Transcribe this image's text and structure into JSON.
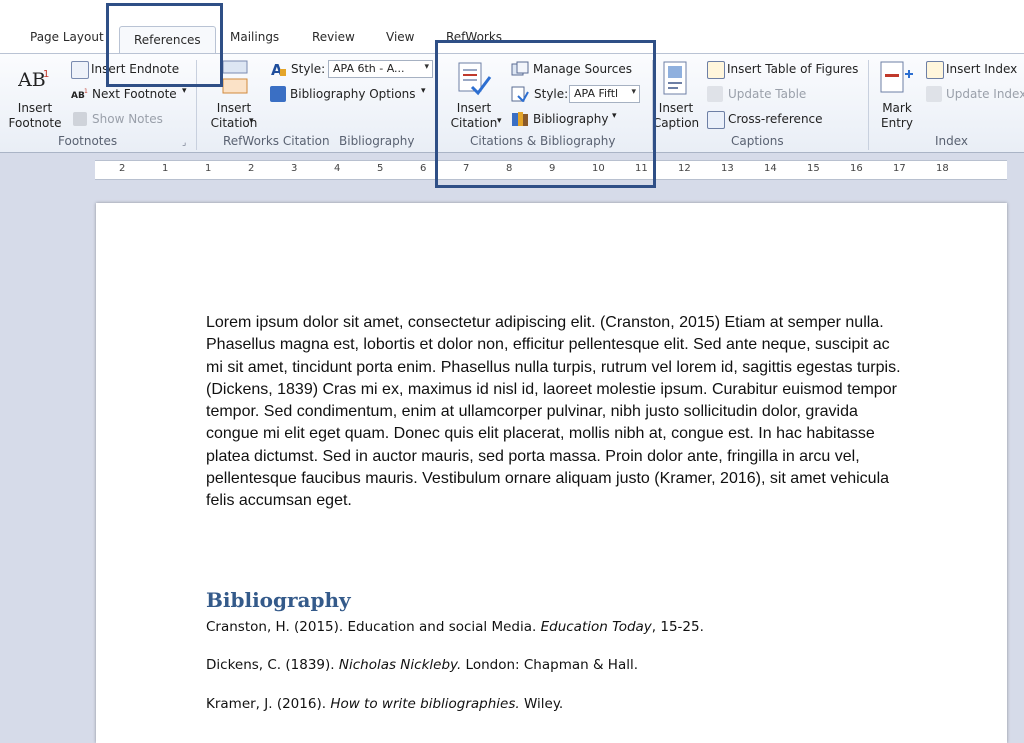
{
  "tabs": {
    "page_layout": "Page Layout",
    "references": "References",
    "mailings": "Mailings",
    "review": "Review",
    "view": "View",
    "refworks": "RefWorks"
  },
  "ribbon": {
    "footnotes": {
      "insert_footnote": "Insert Footnote",
      "insert_footnote_l1": "Insert",
      "insert_footnote_l2": "Footnote",
      "insert_endnote": "Insert Endnote",
      "next_footnote": "Next Footnote",
      "show_notes": "Show Notes",
      "group_label": "Footnotes"
    },
    "refworks": {
      "insert_citation_l1": "Insert",
      "insert_citation_l2": "Citation",
      "style_label": "Style:",
      "style_value": "APA 6th - A...",
      "bibliography_options": "Bibliography Options",
      "group_label": "RefWorks Citation",
      "group_label_2": "Bibliography"
    },
    "citations": {
      "insert_citation_l1": "Insert",
      "insert_citation_l2": "Citation",
      "manage_sources": "Manage Sources",
      "style_label": "Style:",
      "style_value": "APA Fiftl",
      "bibliography": "Bibliography",
      "group_label": "Citations & Bibliography"
    },
    "captions": {
      "insert_caption_l1": "Insert",
      "insert_caption_l2": "Caption",
      "insert_table_of_figures": "Insert Table of Figures",
      "update_table": "Update Table",
      "cross_reference": "Cross-reference",
      "group_label": "Captions"
    },
    "index": {
      "mark_entry_l1": "Mark",
      "mark_entry_l2": "Entry",
      "insert_index": "Insert Index",
      "update_index": "Update Index",
      "group_label": "Index"
    }
  },
  "ruler": {
    "numbers": [
      "2",
      "1",
      "1",
      "2",
      "3",
      "4",
      "5",
      "6",
      "7",
      "8",
      "9",
      "10",
      "11",
      "12",
      "13",
      "14",
      "15",
      "16",
      "17",
      "18"
    ]
  },
  "document": {
    "body": "Lorem ipsum dolor sit amet, consectetur adipiscing elit. (Cranston, 2015) Etiam at semper nulla. Phasellus magna est, lobortis et dolor non, efficitur pellentesque elit. Sed ante neque, suscipit ac mi sit amet, tincidunt porta enim. Phasellus nulla turpis, rutrum vel lorem id, sagittis egestas turpis. (Dickens, 1839) Cras mi ex, maximus id nisl id, laoreet molestie ipsum. Curabitur euismod tempor tempor. Sed condimentum, enim at ullamcorper pulvinar, nibh justo sollicitudin dolor, gravida congue mi elit eget quam. Donec quis elit placerat, mollis nibh at, congue est. In hac habitasse platea dictumst. Sed in auctor mauris, sed porta massa. Proin dolor ante, fringilla in arcu vel, pellentesque faucibus mauris. Vestibulum ornare aliquam justo (Kramer, 2016), sit amet vehicula felis accumsan eget.",
    "bibliography_title": "Bibliography",
    "entries": [
      {
        "pre": "Cranston, H. (2015). Education and social Media. ",
        "ital": "Education Today",
        "post": ", 15-25."
      },
      {
        "pre": "Dickens, C. (1839). ",
        "ital": "Nicholas Nickleby.",
        "post": " London: Chapman & Hall."
      },
      {
        "pre": "Kramer, J. (2016). ",
        "ital": "How to write bibliographies.",
        "post": " Wiley."
      }
    ]
  },
  "colors": {
    "highlight": "#2f4f86",
    "heading": "#345a8a"
  }
}
